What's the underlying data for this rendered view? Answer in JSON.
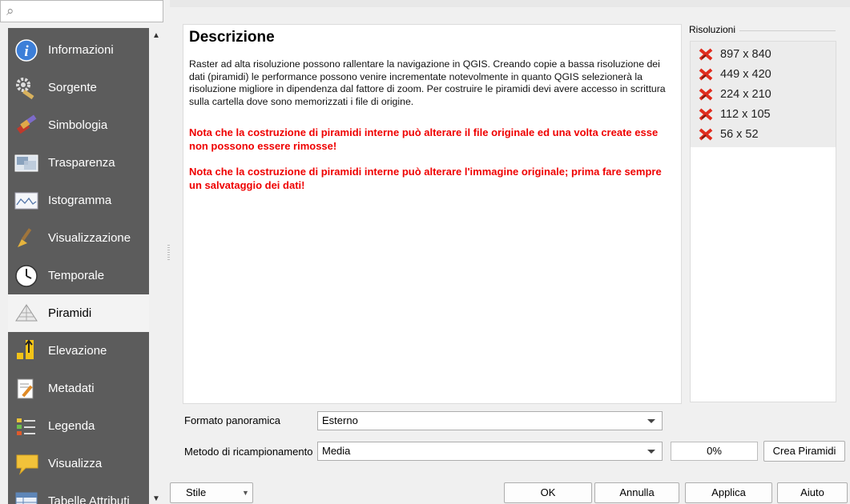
{
  "search": {
    "placeholder": ""
  },
  "sidebar": {
    "items": [
      {
        "label": "Informazioni",
        "icon": "info-icon"
      },
      {
        "label": "Sorgente",
        "icon": "source-settings-icon"
      },
      {
        "label": "Simbologia",
        "icon": "paintbrush-icon"
      },
      {
        "label": "Trasparenza",
        "icon": "transparency-icon"
      },
      {
        "label": "Istogramma",
        "icon": "histogram-icon"
      },
      {
        "label": "Visualizzazione",
        "icon": "rendering-brush-icon"
      },
      {
        "label": "Temporale",
        "icon": "clock-icon"
      },
      {
        "label": "Piramidi",
        "icon": "pyramid-icon"
      },
      {
        "label": "Elevazione",
        "icon": "elevation-icon"
      },
      {
        "label": "Metadati",
        "icon": "metadata-icon"
      },
      {
        "label": "Legenda",
        "icon": "legend-icon"
      },
      {
        "label": "Visualizza",
        "icon": "speech-bubble-icon"
      },
      {
        "label": "Tabelle Attributi",
        "icon": "attribute-table-icon"
      }
    ],
    "selected": "Piramidi"
  },
  "description": {
    "title": "Descrizione",
    "body": "Raster ad alta risoluzione possono rallentare la navigazione in QGIS. Creando copie a bassa risoluzione dei dati (piramidi) le performance possono venire incrementate notevolmente in quanto QGIS selezionerà la risoluzione migliore in dipendenza dal fattore di zoom. Per costruire le piramidi devi avere accesso in scrittura sulla cartella dove sono memorizzati i file di origine.",
    "warning1": "Nota che la costruzione di piramidi interne può alterare il file originale ed una volta create esse non possono essere rimosse!",
    "warning2": "Nota che la costruzione di piramidi interne può alterare l'immagine originale; prima fare sempre un salvataggio dei dati!"
  },
  "resolutions": {
    "label": "Risoluzioni",
    "items": [
      "897 x 840",
      "449 x 420",
      "224 x 210",
      "112 x 105",
      "56 x 52"
    ],
    "icon": "no-pyramid-red-x-icon"
  },
  "controls": {
    "format_label": "Formato panoramica",
    "format_value": "Esterno",
    "resample_label": "Metodo di ricampionamento",
    "resample_value": "Media",
    "progress": "0%",
    "build_button": "Crea Piramidi"
  },
  "footer": {
    "style_button": "Stile",
    "ok": "OK",
    "cancel": "Annulla",
    "apply": "Applica",
    "help": "Aiuto"
  },
  "colors": {
    "sidebar_bg": "#5c5c5c",
    "warning": "#ef0000",
    "selected_bg": "#f3f3f3"
  }
}
